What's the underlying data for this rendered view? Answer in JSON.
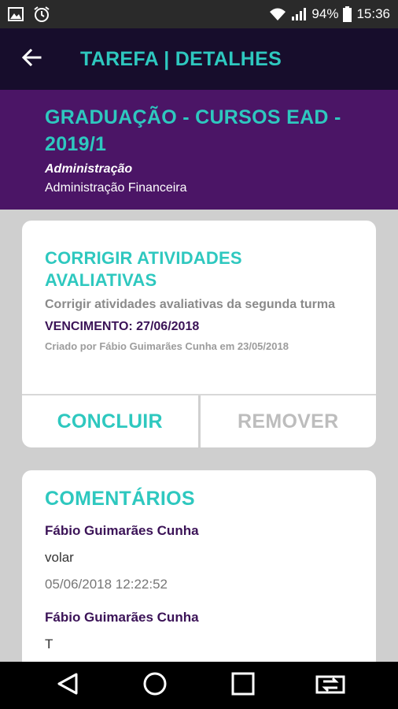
{
  "status_bar": {
    "battery": "94%",
    "time": "15:36",
    "icons": [
      "image-icon",
      "alarm-icon",
      "wifi-icon",
      "signal-icon",
      "battery-icon"
    ]
  },
  "app_bar": {
    "title": "TAREFA | DETALHES",
    "back_icon": "arrow-back-icon"
  },
  "header": {
    "course_title": "GRADUAÇÃO - CURSOS EAD - 2019/1",
    "area": "Administração",
    "subject": "Administração Financeira"
  },
  "task": {
    "title": "CORRIGIR ATIVIDADES AVALIATIVAS",
    "description": "Corrigir atividades avaliativas da segunda turma",
    "due": "VENCIMENTO: 27/06/2018",
    "created": "Criado por Fábio Guimarães Cunha em 23/05/2018",
    "complete_label": "CONCLUIR",
    "remove_label": "REMOVER"
  },
  "comments": {
    "title": "COMENTÁRIOS",
    "items": [
      {
        "author": "Fábio Guimarães Cunha",
        "text": "volar",
        "time": "05/06/2018 12:22:52"
      },
      {
        "author": "Fábio Guimarães Cunha",
        "text": "T",
        "time": ""
      }
    ]
  },
  "nav_bar": {
    "icons": [
      "back-triangle-icon",
      "home-circle-icon",
      "recents-square-icon",
      "switch-screen-icon"
    ]
  },
  "colors": {
    "accent": "#2ec8bf",
    "app_bar_bg": "#170d2c",
    "header_bg": "#4b1566",
    "dark_text": "#3b1357"
  }
}
